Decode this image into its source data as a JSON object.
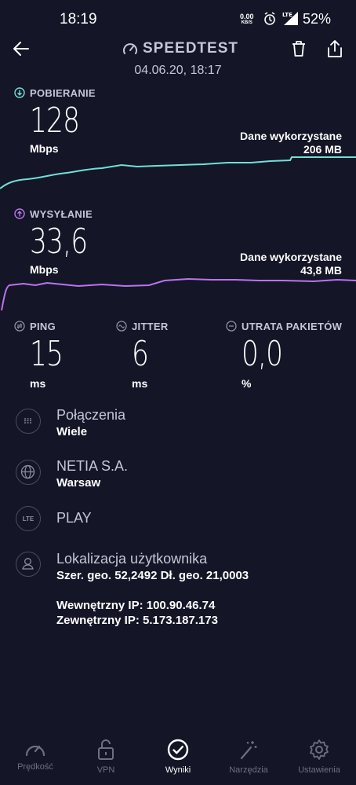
{
  "status_bar": {
    "time": "18:19",
    "net_speed_value": "0.00",
    "net_speed_unit": "KB/S",
    "network": "LTE",
    "battery": "52%"
  },
  "header": {
    "title": "SPEEDTEST",
    "datetime": "04.06.20, 18:17",
    "back_icon": "arrow-left-icon",
    "delete_icon": "trash-icon",
    "share_icon": "share-icon"
  },
  "download": {
    "label": "POBIERANIE",
    "value": "128",
    "unit": "Mbps",
    "data_used_label": "Dane wykorzystane",
    "data_used_value": "206 MB",
    "color": "#6fe0d8"
  },
  "upload": {
    "label": "WYSYŁANIE",
    "value": "33,6",
    "unit": "Mbps",
    "data_used_label": "Dane wykorzystane",
    "data_used_value": "43,8 MB",
    "color": "#bb73f0"
  },
  "metrics": {
    "ping": {
      "label": "PING",
      "value": "15",
      "unit": "ms"
    },
    "jitter": {
      "label": "JITTER",
      "value": "6",
      "unit": "ms"
    },
    "packet_loss": {
      "label": "UTRATA PAKIETÓW",
      "value": "0,0",
      "unit": "%"
    }
  },
  "info": {
    "connections": {
      "title": "Połączenia",
      "value": "Wiele"
    },
    "provider": {
      "title": "NETIA S.A.",
      "value": "Warsaw"
    },
    "network": {
      "icon_text": "LTE",
      "title": "PLAY"
    },
    "location": {
      "title": "Lokalizacja użytkownika",
      "coords": "Szer. geo. 52,2492 Dł. geo. 21,0003",
      "internal_ip": "Wewnętrzny IP: 100.90.46.74",
      "external_ip": "Zewnętrzny IP: 5.173.187.173"
    }
  },
  "bottom_nav": [
    {
      "label": "Prędkość",
      "icon": "speedometer-icon"
    },
    {
      "label": "VPN",
      "icon": "lock-icon"
    },
    {
      "label": "Wyniki",
      "icon": "check-circle-icon",
      "active": true
    },
    {
      "label": "Narzędzia",
      "icon": "magic-wand-icon"
    },
    {
      "label": "Ustawienia",
      "icon": "gear-icon"
    }
  ]
}
